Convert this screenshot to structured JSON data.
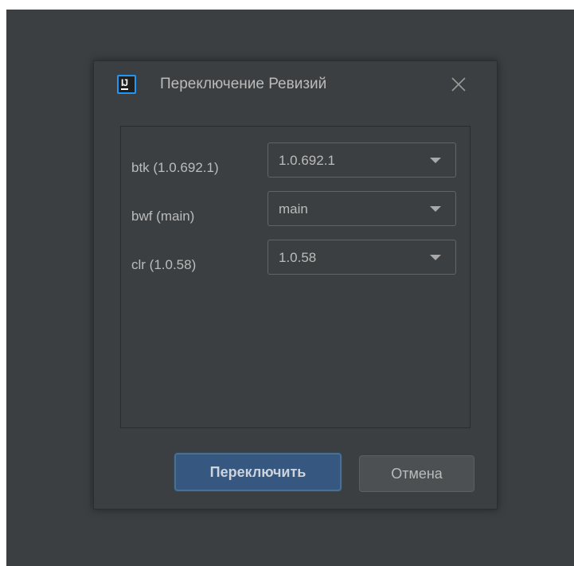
{
  "dialog": {
    "title": "Переключение Ревизий",
    "app_icon": "intellij-idea-icon",
    "close_icon": "close-icon"
  },
  "rows": [
    {
      "label": "btk (1.0.692.1)",
      "value": "1.0.692.1"
    },
    {
      "label": "bwf (main)",
      "value": "main"
    },
    {
      "label": "clr (1.0.58)",
      "value": "1.0.58"
    }
  ],
  "buttons": {
    "switch_label": "Переключить",
    "cancel_label": "Отмена"
  },
  "colors": {
    "background": "#3c3f41",
    "text": "#bbbbbb",
    "primary_button": "#365880",
    "primary_border": "#4c708c",
    "icon_accent": "#2196f3"
  }
}
